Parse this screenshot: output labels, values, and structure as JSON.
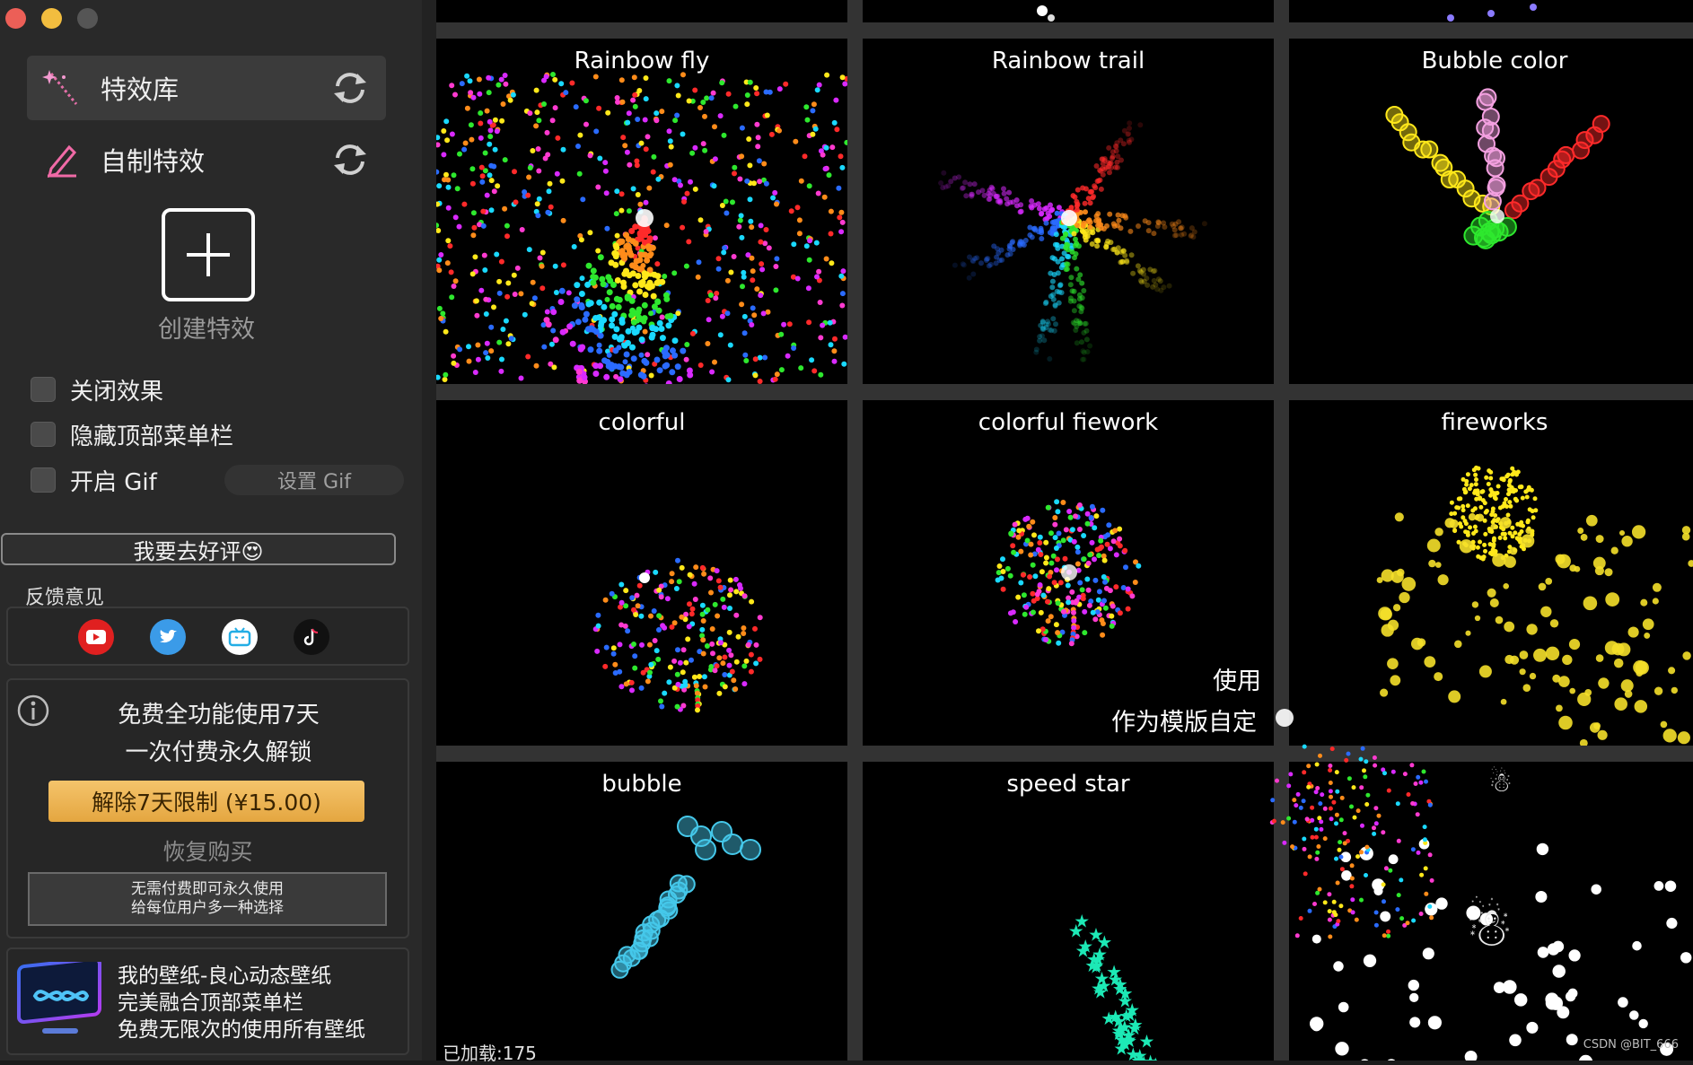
{
  "sidebar": {
    "nav": [
      {
        "label": "特效库",
        "icon": "sparkle-wand-icon",
        "active": true
      },
      {
        "label": "自制特效",
        "icon": "pencil-icon",
        "active": false
      }
    ],
    "create_label": "创建特效",
    "options": [
      {
        "label": "关闭效果",
        "checked": false
      },
      {
        "label": "隐藏顶部菜单栏",
        "checked": false
      },
      {
        "label": "开启 Gif",
        "checked": false
      }
    ],
    "set_gif_label": "设置 Gif",
    "review_label": "我要去好评😍",
    "feedback_title": "反馈意见",
    "social": [
      {
        "icon": "youtube-icon",
        "color": "#e02020"
      },
      {
        "icon": "twitter-icon",
        "color": "#3b9be8"
      },
      {
        "icon": "bilibili-icon",
        "color": "#ffffff"
      },
      {
        "icon": "tiktok-icon",
        "color": "#111111"
      }
    ],
    "promo": {
      "line1": "免费全功能使用7天",
      "line2": "一次付费永久解锁",
      "unlock_label": "解除7天限制 (¥15.00)",
      "restore_label": "恢复购买",
      "free_line1": "无需付费即可永久使用",
      "free_line2": "给每位用户多一种选择"
    },
    "ad": {
      "line1": "我的壁纸-良心动态壁纸",
      "line2": "完美融合顶部菜单栏",
      "line3": "免费无限次的使用所有壁纸"
    }
  },
  "effects": [
    {
      "title": "Rainbow fly"
    },
    {
      "title": "Rainbow trail"
    },
    {
      "title": "Bubble color"
    },
    {
      "title": "colorful"
    },
    {
      "title": "colorful fiework"
    },
    {
      "title": "fireworks"
    },
    {
      "title": "bubble"
    },
    {
      "title": "speed star"
    },
    {
      "title": ""
    }
  ],
  "hover_overlay": {
    "use_label": "使用",
    "template_label": "作为模版自定"
  },
  "status": {
    "loaded_label": "已加载:175"
  },
  "watermark": "CSDN @BIT_666",
  "colors": {
    "accent_orange": "#eeb14f",
    "sidebar_bg": "#292929",
    "tile_bg": "#000000"
  }
}
